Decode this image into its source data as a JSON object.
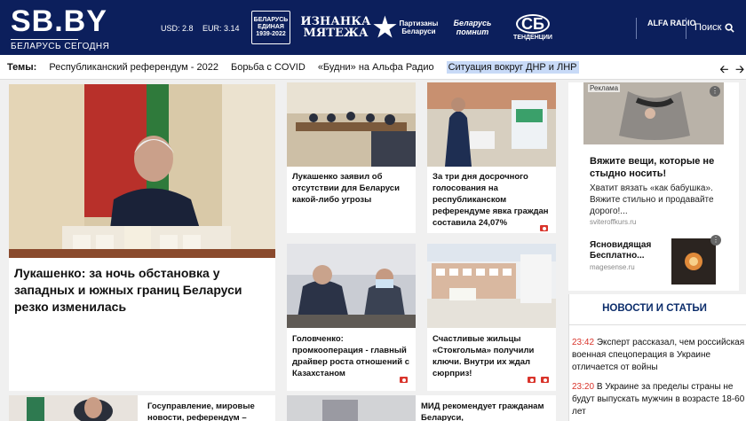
{
  "header": {
    "logo": "SB.BY",
    "logo_sub": "БЕЛАРУСЬ СЕГОДНЯ",
    "usd": "USD: 2.8",
    "eur": "EUR: 3.14",
    "partners": {
      "p1": "БЕЛАРУСЬ ЕДИНАЯ 1939-2022",
      "p2": "ИЗНАНКА МЯТЕЖА",
      "p3": "Партизаны Беларуси",
      "p4": "Беларусь помнит",
      "p5_logo": "СБ",
      "p5_sub": "ТЕНДЕНЦИИ"
    },
    "radio": "ALFA RADIO",
    "search_label": "Поиск",
    "brand_color": "#0c1f5c"
  },
  "themes": {
    "label": "Темы:",
    "items": [
      "Республиканский референдум - 2022",
      "Борьба с COVID",
      "«Будни» на Альфа Радио",
      "Ситуация вокруг ДНР и ЛНР"
    ]
  },
  "main": {
    "big_title": "Лукашенко: за ночь обстановка у западных и южных границ Беларуси резко изменилась",
    "cards": [
      "Лукашенко заявил об отсутствии для Беларуси какой-либо угрозы",
      "За три дня досрочного голосования на республиканском референдуме явка граждан составила 24,07%",
      "Головченко: промкооперация - главный драйвер роста отношений с Казахстаном",
      "Счастливые жильцы «Стокгольма» получили ключи. Внутри их ждал сюрприз!",
      "Госуправление, мировые новости, референдум –",
      "МИД рекомендует гражданам Беларуси,"
    ]
  },
  "ad": {
    "label": "Реклама",
    "headline": "Вяжите вещи, которые не стыдно носить!",
    "text": "Хватит вязать «как бабушка». Вяжите стильно и продавайте дорого!...",
    "source": "sviteroffkurs.ru",
    "headline2": "Ясновидящая Бесплатно...",
    "source2": "magesense.ru"
  },
  "news": {
    "title": "НОВОСТИ И СТАТЬИ",
    "items": [
      {
        "time": "23:42",
        "text": "Эксперт рассказал, чем российская военная спецоперация в Украине отличается от войны"
      },
      {
        "time": "23:20",
        "text": "В Украине за пределы страны не будут выпускать мужчин в возрасте 18-60 лет"
      }
    ]
  }
}
